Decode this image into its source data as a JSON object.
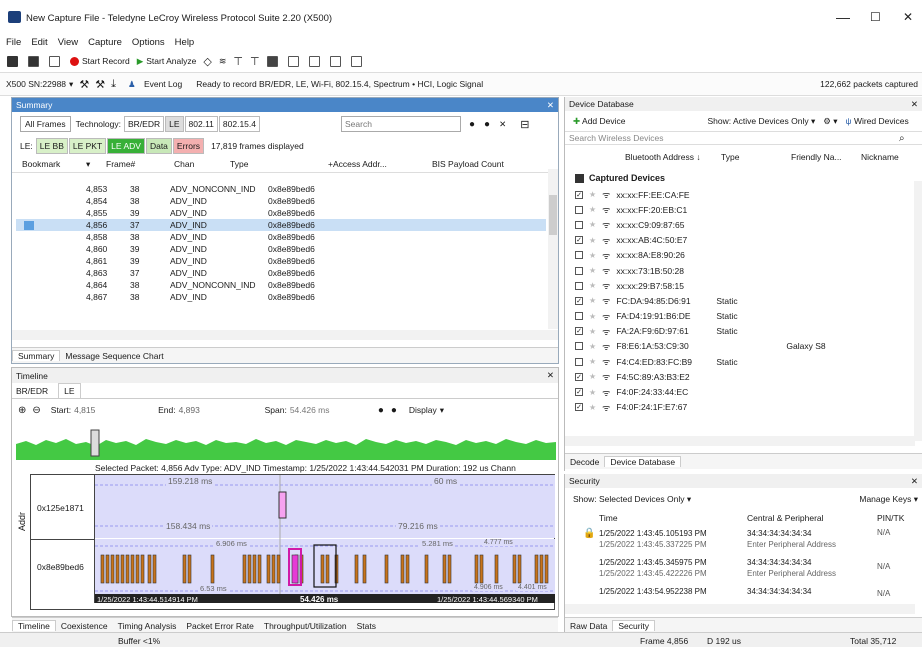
{
  "window": {
    "title": "New Capture File - Teledyne LeCroy Wireless Protocol Suite 2.20 (X500)",
    "minimize": "—",
    "maximize": "☐",
    "close": "✕"
  },
  "menu": [
    "File",
    "Edit",
    "View",
    "Capture",
    "Options",
    "Help"
  ],
  "toolbar": {
    "start_record": "Start Record",
    "start_analyze": "Start Analyze"
  },
  "statusline": {
    "device": "X500 SN:22988",
    "event_log": "Event Log",
    "ready": "Ready to record BR/EDR, LE, Wi-Fi, 802.15.4, Spectrum • HCI, Logic Signal",
    "packets": "122,662 packets captured"
  },
  "summary": {
    "title": "Summary",
    "close": "✕",
    "all_frames": "All Frames",
    "technology": "Technology:",
    "techs": [
      "BR/EDR",
      "LE",
      "802.11",
      "802.15.4"
    ],
    "search_placeholder": "Search",
    "le_label": "LE:",
    "le_filters": [
      "LE BB",
      "LE PKT",
      "LE ADV",
      "Data",
      "Errors"
    ],
    "frames_displayed": "17,819 frames displayed",
    "columns": [
      "Bookmark",
      "Frame#",
      "Chan",
      "Type",
      "+Access Addr...",
      "BIS Payload Count"
    ],
    "rows": [
      {
        "frame": "4,853",
        "chan": "38",
        "type": "ADV_NONCONN_IND",
        "addr": "0x8e89bed6"
      },
      {
        "frame": "4,854",
        "chan": "38",
        "type": "ADV_IND",
        "addr": "0x8e89bed6"
      },
      {
        "frame": "4,855",
        "chan": "39",
        "type": "ADV_IND",
        "addr": "0x8e89bed6"
      },
      {
        "frame": "4,856",
        "chan": "37",
        "type": "ADV_IND",
        "addr": "0x8e89bed6"
      },
      {
        "frame": "4,858",
        "chan": "38",
        "type": "ADV_IND",
        "addr": "0x8e89bed6"
      },
      {
        "frame": "4,860",
        "chan": "39",
        "type": "ADV_IND",
        "addr": "0x8e89bed6"
      },
      {
        "frame": "4,861",
        "chan": "39",
        "type": "ADV_IND",
        "addr": "0x8e89bed6"
      },
      {
        "frame": "4,863",
        "chan": "37",
        "type": "ADV_IND",
        "addr": "0x8e89bed6"
      },
      {
        "frame": "4,864",
        "chan": "38",
        "type": "ADV_NONCONN_IND",
        "addr": "0x8e89bed6"
      },
      {
        "frame": "4,867",
        "chan": "38",
        "type": "ADV_IND",
        "addr": "0x8e89bed6"
      }
    ],
    "tabs": [
      "Summary",
      "Message Sequence Chart"
    ]
  },
  "timeline": {
    "title": "Timeline",
    "close": "✕",
    "tabs": [
      "BR/EDR",
      "LE"
    ],
    "start_label": "Start:",
    "start": "4,815",
    "end_label": "End:",
    "end": "4,893",
    "span_label": "Span:",
    "span": "54.426 ms",
    "display": "Display",
    "selected": "Selected Packet: 4,856   Adv Type: ADV_IND   Timestamp: 1/25/2022 1:43:44.542031 PM   Duration: 192 us   Chann",
    "addr_axis": "Addr",
    "addr1": "0x125e1871",
    "addr2": "0x8e89bed6",
    "m1": "159.218 ms",
    "m2": "60 ms",
    "m3": "158.434 ms",
    "m4": "79.216 ms",
    "m5": "6.906 ms",
    "m6": "5.281 ms",
    "m7": "4.777 ms",
    "m8": "6.53 ms",
    "m9": "4.906 ms",
    "m10": "4.401 ms",
    "t_start": "1/25/2022 1:43:44.514914 PM",
    "t_span": "54.426 ms",
    "t_end": "1/25/2022 1:43:44.569340 PM",
    "bottom_tabs": [
      "Timeline",
      "Coexistence",
      "Timing Analysis",
      "Packet Error Rate",
      "Throughput/Utilization",
      "Stats"
    ]
  },
  "devices": {
    "title": "Device Database",
    "close": "✕",
    "add": "Add Device",
    "show": "Show: Active Devices Only",
    "wired": "Wired Devices",
    "search_placeholder": "Search Wireless Devices",
    "columns": [
      "Bluetooth Address",
      "Type",
      "Friendly Na...",
      "Nickname"
    ],
    "group": "Captured Devices",
    "rows": [
      {
        "check": "✓",
        "mac": "xx:xx:FF:EE:CA:FE",
        "type": "",
        "name": ""
      },
      {
        "check": "",
        "mac": "xx:xx:FF:20:EB:C1",
        "type": "",
        "name": ""
      },
      {
        "check": "",
        "mac": "xx:xx:C9:09:87:65",
        "type": "",
        "name": ""
      },
      {
        "check": "✓",
        "mac": "xx:xx:AB:4C:50:E7",
        "type": "",
        "name": ""
      },
      {
        "check": "",
        "mac": "xx:xx:8A:E8:90:26",
        "type": "",
        "name": ""
      },
      {
        "check": "",
        "mac": "xx:xx:73:1B:50:28",
        "type": "",
        "name": ""
      },
      {
        "check": "",
        "mac": "xx:xx:29:B7:58:15",
        "type": "",
        "name": ""
      },
      {
        "check": "✓",
        "mac": "FC:DA:94:85:D6:91",
        "type": "Static",
        "name": ""
      },
      {
        "check": "",
        "mac": "FA:D4:19:91:B6:DE",
        "type": "Static",
        "name": ""
      },
      {
        "check": "✓",
        "mac": "FA:2A:F9:6D:97:61",
        "type": "Static",
        "name": ""
      },
      {
        "check": "",
        "mac": "F8:E6:1A:53:C9:30",
        "type": "",
        "name": "Galaxy S8"
      },
      {
        "check": "",
        "mac": "F4:C4:ED:83:FC:B9",
        "type": "Static",
        "name": ""
      },
      {
        "check": "✓",
        "mac": "F4:5C:89:A3:B3:E2",
        "type": "",
        "name": ""
      },
      {
        "check": "✓",
        "mac": "F4:0F:24:33:44:EC",
        "type": "",
        "name": ""
      },
      {
        "check": "✓",
        "mac": "F4:0F:24:1F:E7:67",
        "type": "",
        "name": ""
      }
    ],
    "tabs": [
      "Decode",
      "Device Database"
    ]
  },
  "security": {
    "title": "Security",
    "close": "✕",
    "show": "Show: Selected Devices Only",
    "manage": "Manage Keys",
    "columns": [
      "Time",
      "Central & Peripheral",
      "PIN/TK"
    ],
    "rows": [
      {
        "t1": "1/25/2022 1:43:45.105193 PM",
        "t2": "1/25/2022 1:43:45.337225 PM",
        "c1": "34:34:34:34:34:34",
        "c2": "Enter Peripheral Address",
        "p": "N/A"
      },
      {
        "t1": "1/25/2022 1:43:45.345975 PM",
        "t2": "1/25/2022 1:43:45.422226 PM",
        "c1": "34:34:34:34:34:34",
        "c2": "Enter Peripheral Address",
        "p": "N/A"
      },
      {
        "t1": "1/25/2022 1:43:54.952238 PM",
        "t2": "",
        "c1": "34:34:34:34:34:34",
        "c2": "",
        "p": "N/A"
      }
    ],
    "tabs": [
      "Raw Data",
      "Security"
    ]
  },
  "bottom": {
    "buffer": "Buffer <1%",
    "frame": "Frame 4,856",
    "d": "D 192 us",
    "total": "Total 35,712"
  }
}
